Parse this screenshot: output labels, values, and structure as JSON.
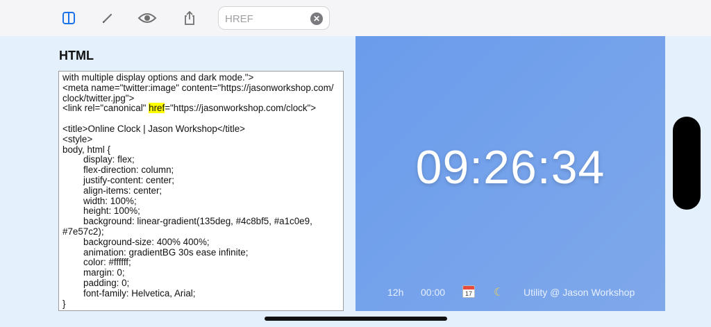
{
  "toolbar": {
    "search_placeholder": "HREF",
    "clear_symbol": "✕"
  },
  "editor": {
    "heading": "HTML",
    "lines": [
      "with multiple display options and dark mode.\">",
      "<meta name=\"twitter:image\" content=\"https://jasonworkshop.com/",
      "clock/twitter.jpg\">",
      "<link rel=\"canonical\" ",
      "",
      "<title>Online Clock | Jason Workshop</title>",
      "<style>",
      "body, html {",
      "display: flex;",
      "flex-direction: column;",
      "justify-content: center;",
      "align-items: center;",
      "width: 100%;",
      "height: 100%;",
      "background: linear-gradient(135deg, #4c8bf5, #a1c0e9,",
      "#7e57c2);",
      "background-size: 400% 400%;",
      "animation: gradientBG 30s ease infinite;",
      "color: #ffffff;",
      "margin: 0;",
      "padding: 0;",
      "font-family: Helvetica, Arial;",
      "}"
    ],
    "highlight_word": "href",
    "canonical_rest": "=\"https://jasonworkshop.com/clock\">"
  },
  "preview": {
    "time": "09:26:34",
    "format_label": "12h",
    "seconds_label": "00:00",
    "calendar_day": "17",
    "moon_glyph": "☾",
    "credit": "Utility @ Jason Workshop"
  },
  "colors": {
    "accent": "#1a73e8",
    "highlight": "#ffff00",
    "preview_gradient_start": "#6a9cec",
    "preview_gradient_end": "#7fa8ea"
  },
  "icons": [
    "split-view-icon",
    "pencil-icon",
    "eye-icon",
    "share-icon",
    "clear-search-icon",
    "calendar-icon",
    "moon-icon"
  ]
}
